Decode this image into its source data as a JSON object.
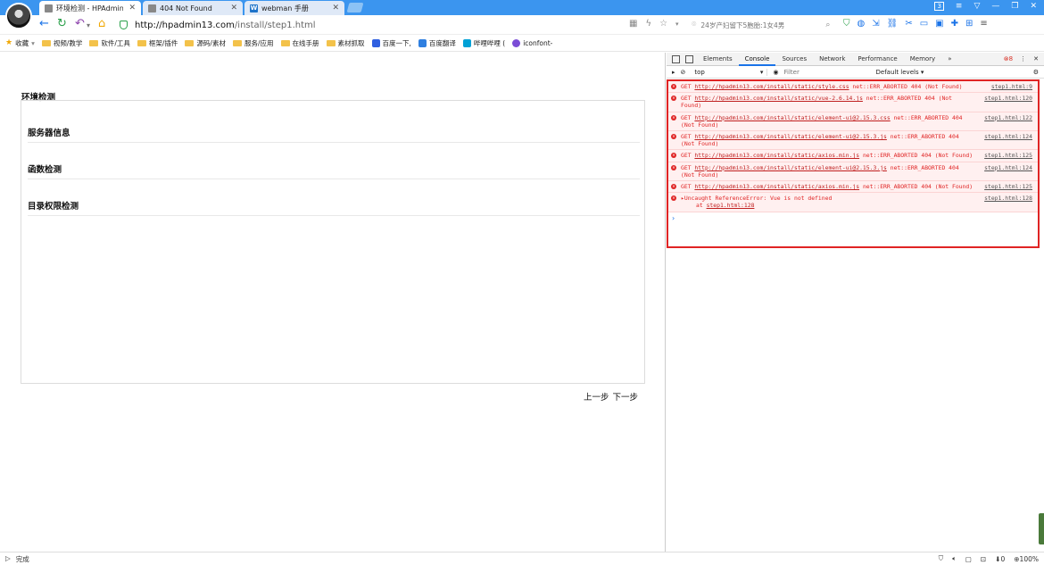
{
  "tabs": [
    {
      "label": "环境检测 - HPAdmin",
      "active": true
    },
    {
      "label": "404 Not Found",
      "active": false
    },
    {
      "label": "webman 手册",
      "active": false
    }
  ],
  "toolbar": {
    "url_domain": "http://hpadmin13.com",
    "url_path": "/install/step1.html",
    "search_placeholder": "24岁产妇留下5胞胎:1女4男",
    "tab_count": "3"
  },
  "bookmarks": [
    "收藏",
    "视频/教学",
    "软件/工具",
    "框架/插件",
    "源码/素材",
    "服务/应用",
    "在线手册",
    "素材抓取",
    "百度一下,",
    "百度翻译",
    "哔哩哔哩 (",
    "iconfont-"
  ],
  "page": {
    "section_title": "环境检测",
    "groups": [
      "服务器信息",
      "函数检测",
      "目录权限检测"
    ],
    "prev": "上一步",
    "next": "下一步"
  },
  "devtools": {
    "tabs": [
      "Elements",
      "Console",
      "Sources",
      "Network",
      "Performance",
      "Memory",
      "»"
    ],
    "active_tab": "Console",
    "error_count": "8",
    "context": "top",
    "filter_placeholder": "Filter",
    "levels": "Default levels ▾",
    "logs": [
      {
        "method": "GET",
        "url": "http://hpadmin13.com/install/static/style.css",
        "msg": "net::ERR_ABORTED 404 (Not Found)",
        "src": "step1.html:9"
      },
      {
        "method": "GET",
        "url": "http://hpadmin13.com/install/static/vue-2.6.14.js",
        "msg": "net::ERR_ABORTED 404 (Not Found)",
        "src": "step1.html:120"
      },
      {
        "method": "GET",
        "url": "http://hpadmin13.com/install/static/element-ui@2.15.3.css",
        "msg": "net::ERR_ABORTED 404 (Not Found)",
        "src": "step1.html:122"
      },
      {
        "method": "GET",
        "url": "http://hpadmin13.com/install/static/element-ui@2.15.3.js",
        "msg": "net::ERR_ABORTED 404 (Not Found)",
        "src": "step1.html:124"
      },
      {
        "method": "GET",
        "url": "http://hpadmin13.com/install/static/axios.min.js",
        "msg": "net::ERR_ABORTED 404 (Not Found)",
        "src": "step1.html:125"
      },
      {
        "method": "GET",
        "url": "http://hpadmin13.com/install/static/element-ui@2.15.3.js",
        "msg": "net::ERR_ABORTED 404 (Not Found)",
        "src": "step1.html:124"
      },
      {
        "method": "GET",
        "url": "http://hpadmin13.com/install/static/axios.min.js",
        "msg": "net::ERR_ABORTED 404 (Not Found)",
        "src": "step1.html:125"
      }
    ],
    "uncaught": {
      "text": "▸Uncaught ReferenceError: Vue is not defined",
      "at_prefix": "at",
      "at_link": "step1.html:128",
      "src": "step1.html:128"
    }
  },
  "status": {
    "left": "完成",
    "zoom": "100%",
    "downloads": "0"
  }
}
